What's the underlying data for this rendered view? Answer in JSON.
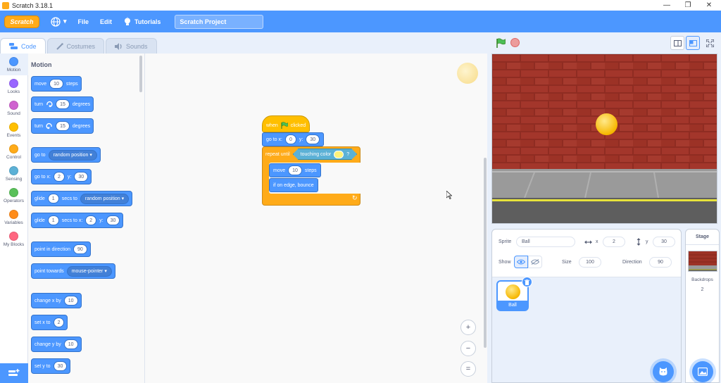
{
  "window": {
    "title": "Scratch 3.18.1",
    "minimize": "—",
    "maximize": "❐",
    "close": "✕"
  },
  "menubar": {
    "logo": "Scratch",
    "globe_caret": "▾",
    "file": "File",
    "edit": "Edit",
    "tutorials": "Tutorials",
    "project_title": "Scratch Project"
  },
  "tabs": {
    "code": "Code",
    "costumes": "Costumes",
    "sounds": "Sounds"
  },
  "categories": [
    {
      "label": "Motion",
      "color": "#4c97ff"
    },
    {
      "label": "Looks",
      "color": "#9966ff"
    },
    {
      "label": "Sound",
      "color": "#cf63cf"
    },
    {
      "label": "Events",
      "color": "#ffbf00"
    },
    {
      "label": "Control",
      "color": "#ffab19"
    },
    {
      "label": "Sensing",
      "color": "#5cb1d6"
    },
    {
      "label": "Operators",
      "color": "#59c059"
    },
    {
      "label": "Variables",
      "color": "#ff8c1a"
    },
    {
      "label": "My Blocks",
      "color": "#ff6680"
    }
  ],
  "palette": {
    "heading": "Motion",
    "move": {
      "a": "move",
      "n": "10",
      "b": "steps"
    },
    "turn_cw": {
      "a": "turn",
      "n": "15",
      "b": "degrees"
    },
    "turn_ccw": {
      "a": "turn",
      "n": "15",
      "b": "degrees"
    },
    "goto": {
      "a": "go to",
      "opt": "random position ▾"
    },
    "goto_xy": {
      "a": "go to x:",
      "x": "2",
      "b": "y:",
      "y": "30"
    },
    "glide": {
      "a": "glide",
      "n": "1",
      "b": "secs to",
      "opt": "random position ▾"
    },
    "glide_xy": {
      "a": "glide",
      "n": "1",
      "b": "secs to x:",
      "x": "2",
      "c": "y:",
      "y": "30"
    },
    "point_dir": {
      "a": "point in direction",
      "n": "90"
    },
    "point_towards": {
      "a": "point towards",
      "opt": "mouse-pointer ▾"
    },
    "change_x": {
      "a": "change x by",
      "n": "10"
    },
    "set_x": {
      "a": "set x to",
      "n": "2"
    },
    "change_y": {
      "a": "change y by",
      "n": "10"
    },
    "set_y": {
      "a": "set y to",
      "n": "30"
    }
  },
  "script": {
    "hat": {
      "a": "when",
      "b": "clicked"
    },
    "goto": {
      "a": "go to x:",
      "x": "0",
      "b": "y:",
      "y": "30"
    },
    "repeat": {
      "a": "repeat until",
      "cond": "touching color",
      "q": "?"
    },
    "move": {
      "a": "move",
      "n": "10",
      "b": "steps"
    },
    "bounce": "if on edge, bounce",
    "loop_arrow": "↻"
  },
  "zoom": {
    "in": "+",
    "out": "−",
    "reset": "="
  },
  "sprite_info": {
    "sprite_label": "Sprite",
    "sprite_name": "Ball",
    "x_label": "x",
    "x": "2",
    "y_label": "y",
    "y": "30",
    "show_label": "Show",
    "size_label": "Size",
    "size": "100",
    "direction_label": "Direction",
    "direction": "90"
  },
  "sprites": [
    {
      "name": "Ball"
    }
  ],
  "stage_pane": {
    "title": "Stage",
    "backdrops_label": "Backdrops",
    "backdrops_count": "2"
  },
  "colors": {
    "accent": "#4c97ff",
    "events": "#ffbf00",
    "control": "#ffab19",
    "sensing": "#5cb1d6"
  }
}
